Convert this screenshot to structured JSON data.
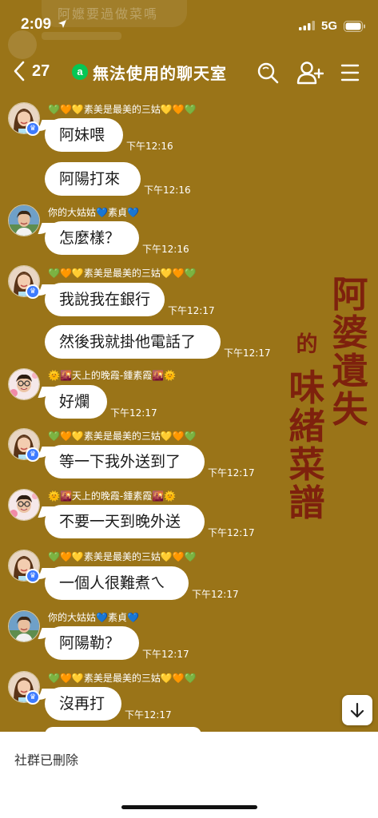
{
  "status_bar": {
    "time": "2:09",
    "network": "5G",
    "faded_preview": "阿嬤要過做菜嗎"
  },
  "nav": {
    "back_count": "27",
    "badge": "a",
    "title": "無法使用的聊天室"
  },
  "watermark": {
    "line1": "阿婆遺失",
    "line2_small": "的",
    "line2": "味緒菜譜"
  },
  "messages": [
    {
      "sender": "💚🧡💛素美是最美的三姑💛🧡💚",
      "avatar": "woman",
      "text": "阿妹喂",
      "time": "下午12:16"
    },
    {
      "sender": "",
      "avatar": "",
      "text": "阿陽打來",
      "time": "下午12:16"
    },
    {
      "sender": "你的大姑姑💙素貞💙",
      "avatar": "auntie",
      "text": "怎麼樣？",
      "time": "下午12:16"
    },
    {
      "sender": "💚🧡💛素美是最美的三姑💛🧡💚",
      "avatar": "woman",
      "text": "我說我在銀行",
      "time": "下午12:17"
    },
    {
      "sender": "",
      "avatar": "",
      "text": "然後我就掛他電話了",
      "time": "下午12:17"
    },
    {
      "sender": "🌞🌇天上的晚霞-鍾素霞🌇🌞",
      "avatar": "glasses",
      "text": "好爛",
      "time": "下午12:17"
    },
    {
      "sender": "💚🧡💛素美是最美的三姑💛🧡💚",
      "avatar": "woman",
      "text": "等一下我外送到了",
      "time": "下午12:17"
    },
    {
      "sender": "🌞🌇天上的晚霞-鍾素霞🌇🌞",
      "avatar": "glasses",
      "text": "不要一天到晚外送",
      "time": "下午12:17"
    },
    {
      "sender": "💚🧡💛素美是最美的三姑💛🧡💚",
      "avatar": "woman",
      "text": "一個人很難煮ㄟ",
      "time": "下午12:17"
    },
    {
      "sender": "你的大姑姑💙素貞💙",
      "avatar": "auntie",
      "text": "阿陽勒？",
      "time": "下午12:17"
    },
    {
      "sender": "💚🧡💛素美是最美的三姑💛🧡💚",
      "avatar": "woman",
      "text": "沒再打",
      "time": "下午12:17"
    }
  ],
  "footer": {
    "notice": "社群已刪除"
  },
  "colors": {
    "background": "#9a7418",
    "bubble": "#ffffff",
    "watermark": "#7d1d0d",
    "line_green": "#06c755"
  }
}
